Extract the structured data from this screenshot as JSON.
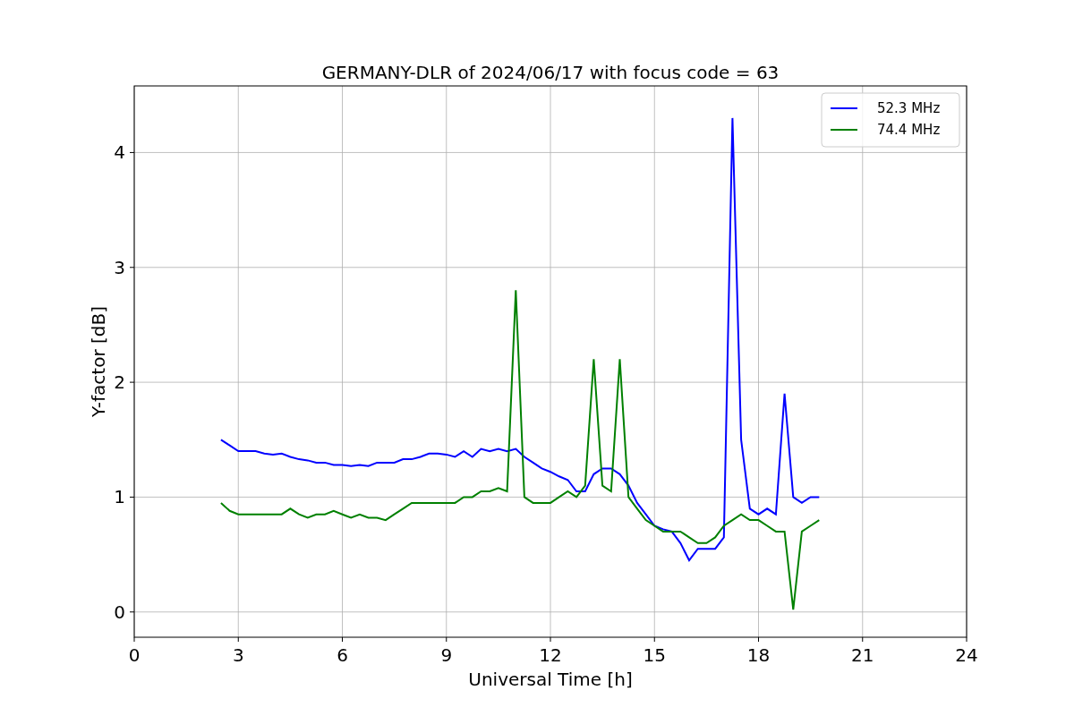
{
  "figure": {
    "chart_data": {
      "type": "line",
      "title": "GERMANY-DLR of 2024/06/17 with focus code = 63",
      "xlabel": "Universal Time [h]",
      "ylabel": "Y-factor [dB]",
      "x": [
        2.5,
        2.75,
        3,
        3.25,
        3.5,
        3.75,
        4,
        4.25,
        4.5,
        4.75,
        5,
        5.25,
        5.5,
        5.75,
        6,
        6.25,
        6.5,
        6.75,
        7,
        7.25,
        7.5,
        7.75,
        8,
        8.25,
        8.5,
        8.75,
        9,
        9.25,
        9.5,
        9.75,
        10,
        10.25,
        10.5,
        10.75,
        11,
        11.25,
        11.5,
        11.75,
        12,
        12.25,
        12.5,
        12.75,
        13,
        13.25,
        13.5,
        13.75,
        14,
        14.25,
        14.5,
        14.75,
        15,
        15.25,
        15.5,
        15.75,
        16,
        16.25,
        16.5,
        16.75,
        17,
        17.25,
        17.5,
        17.75,
        18,
        18.25,
        18.5,
        18.75,
        19,
        19.25,
        19.5,
        19.75
      ],
      "series": [
        {
          "name": "52.3 MHz",
          "color": "#0000ff",
          "values": [
            1.5,
            1.45,
            1.4,
            1.4,
            1.4,
            1.38,
            1.37,
            1.38,
            1.35,
            1.33,
            1.32,
            1.3,
            1.3,
            1.28,
            1.28,
            1.27,
            1.28,
            1.27,
            1.3,
            1.3,
            1.3,
            1.33,
            1.33,
            1.35,
            1.38,
            1.38,
            1.37,
            1.35,
            1.4,
            1.35,
            1.42,
            1.4,
            1.42,
            1.4,
            1.42,
            1.35,
            1.3,
            1.25,
            1.22,
            1.18,
            1.15,
            1.05,
            1.05,
            1.2,
            1.25,
            1.25,
            1.2,
            1.1,
            0.95,
            0.85,
            0.75,
            0.72,
            0.7,
            0.6,
            0.45,
            0.55,
            0.55,
            0.55,
            0.65,
            4.3,
            1.5,
            0.9,
            0.85,
            0.9,
            0.85,
            1.9,
            1.0,
            0.95,
            1.0,
            1.0
          ]
        },
        {
          "name": "74.4 MHz",
          "color": "#008000",
          "values": [
            0.95,
            0.88,
            0.85,
            0.85,
            0.85,
            0.85,
            0.85,
            0.85,
            0.9,
            0.85,
            0.82,
            0.85,
            0.85,
            0.88,
            0.85,
            0.82,
            0.85,
            0.82,
            0.82,
            0.8,
            0.85,
            0.9,
            0.95,
            0.95,
            0.95,
            0.95,
            0.95,
            0.95,
            1.0,
            1.0,
            1.05,
            1.05,
            1.08,
            1.05,
            2.8,
            1.0,
            0.95,
            0.95,
            0.95,
            1.0,
            1.05,
            1.0,
            1.1,
            2.2,
            1.1,
            1.05,
            2.2,
            1.0,
            0.9,
            0.8,
            0.75,
            0.7,
            0.7,
            0.7,
            0.65,
            0.6,
            0.6,
            0.65,
            0.75,
            0.8,
            0.85,
            0.8,
            0.8,
            0.75,
            0.7,
            0.7,
            0.02,
            0.7,
            0.75,
            0.8
          ]
        }
      ],
      "grid": true,
      "legend": "upper right",
      "xlim": [
        0,
        24
      ],
      "ylim": [
        -0.22,
        4.58
      ],
      "xticks": [
        0,
        3,
        6,
        9,
        12,
        15,
        18,
        21,
        24
      ],
      "yticks": [
        0,
        1,
        2,
        3,
        4
      ]
    }
  }
}
